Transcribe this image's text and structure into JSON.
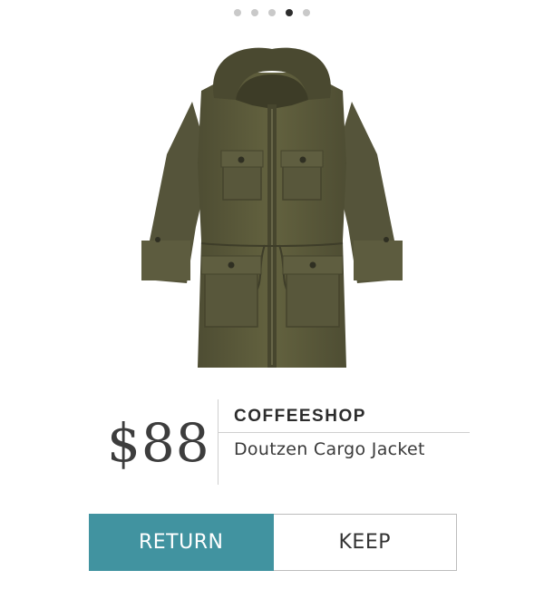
{
  "carousel": {
    "dot_count": 5,
    "active_index": 3
  },
  "product": {
    "image_icon": "olive-cargo-jacket-image",
    "price": "$88",
    "brand": "COFFEESHOP",
    "name": "Doutzen Cargo Jacket"
  },
  "actions": {
    "return_label": "RETURN",
    "keep_label": "KEEP"
  },
  "colors": {
    "accent": "#4193a0",
    "jacket": "#5b5a3d",
    "dot_inactive": "#c9c9c9",
    "dot_active": "#2d2d2d"
  }
}
